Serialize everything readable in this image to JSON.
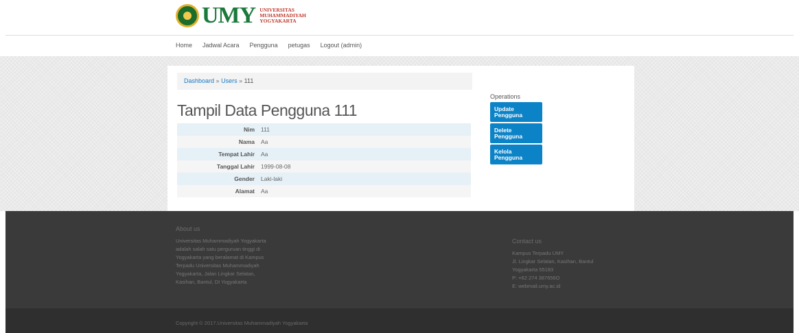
{
  "brand": {
    "name": "UMY",
    "subtitle_lines": [
      "UNIVERSITAS",
      "MUHAMMADIYAH",
      "YOGYAKARTA"
    ]
  },
  "nav": {
    "items": [
      "Home",
      "Jadwal Acara",
      "Pengguna",
      "petugas",
      "Logout (admin)"
    ]
  },
  "breadcrumb": {
    "items": [
      "Dashboard",
      "Users",
      "111"
    ],
    "separator": "»"
  },
  "page": {
    "title": "Tampil Data Pengguna 111"
  },
  "detail": {
    "rows": [
      {
        "label": "Nim",
        "value": "111"
      },
      {
        "label": "Nama",
        "value": "Aa"
      },
      {
        "label": "Tempat Lahir",
        "value": "Aa"
      },
      {
        "label": "Tanggal Lahir",
        "value": "1999-08-08"
      },
      {
        "label": "Gender",
        "value": "Laki-laki"
      },
      {
        "label": "Alamat",
        "value": "Aa"
      }
    ]
  },
  "operations": {
    "title": "Operations",
    "buttons": [
      {
        "line1": "Update",
        "line2": "Pengguna"
      },
      {
        "line1": "Delete",
        "line2": "Pengguna"
      },
      {
        "line1": "Kelola",
        "line2": "Pengguna"
      }
    ]
  },
  "footer": {
    "about_title": "About us",
    "about_lines": [
      "Universitas Muhammadiyah Yogyakarta",
      "adalah salah satu perguruan tinggi di",
      "Yogyakarta yang beralamat di Kampus",
      "Terpadu Universitas Muhammadiyah",
      "Yogyakarta, Jalan Lingkar Selatan,",
      "Kasihan, Bantul, DI Yogyakarta"
    ],
    "contact_title": "Contact us",
    "contact_lines": [
      "Kampus Terpadu UMY",
      "Jl. Lingkar Selatan, Kasihan, Bantul",
      "Yogyakarta 55183",
      "P: +62 274 387656O",
      "E: webmail.umy.ac.id"
    ],
    "copyright": "Copyright © 2017.Universitas Muhammadiyah Yogyakarta"
  },
  "colors": {
    "accent": "#0d83c7",
    "link": "#1a78c2",
    "footer_bg": "#3a3a3a",
    "brand_green": "#1b7a3b",
    "brand_red": "#c0392b"
  }
}
